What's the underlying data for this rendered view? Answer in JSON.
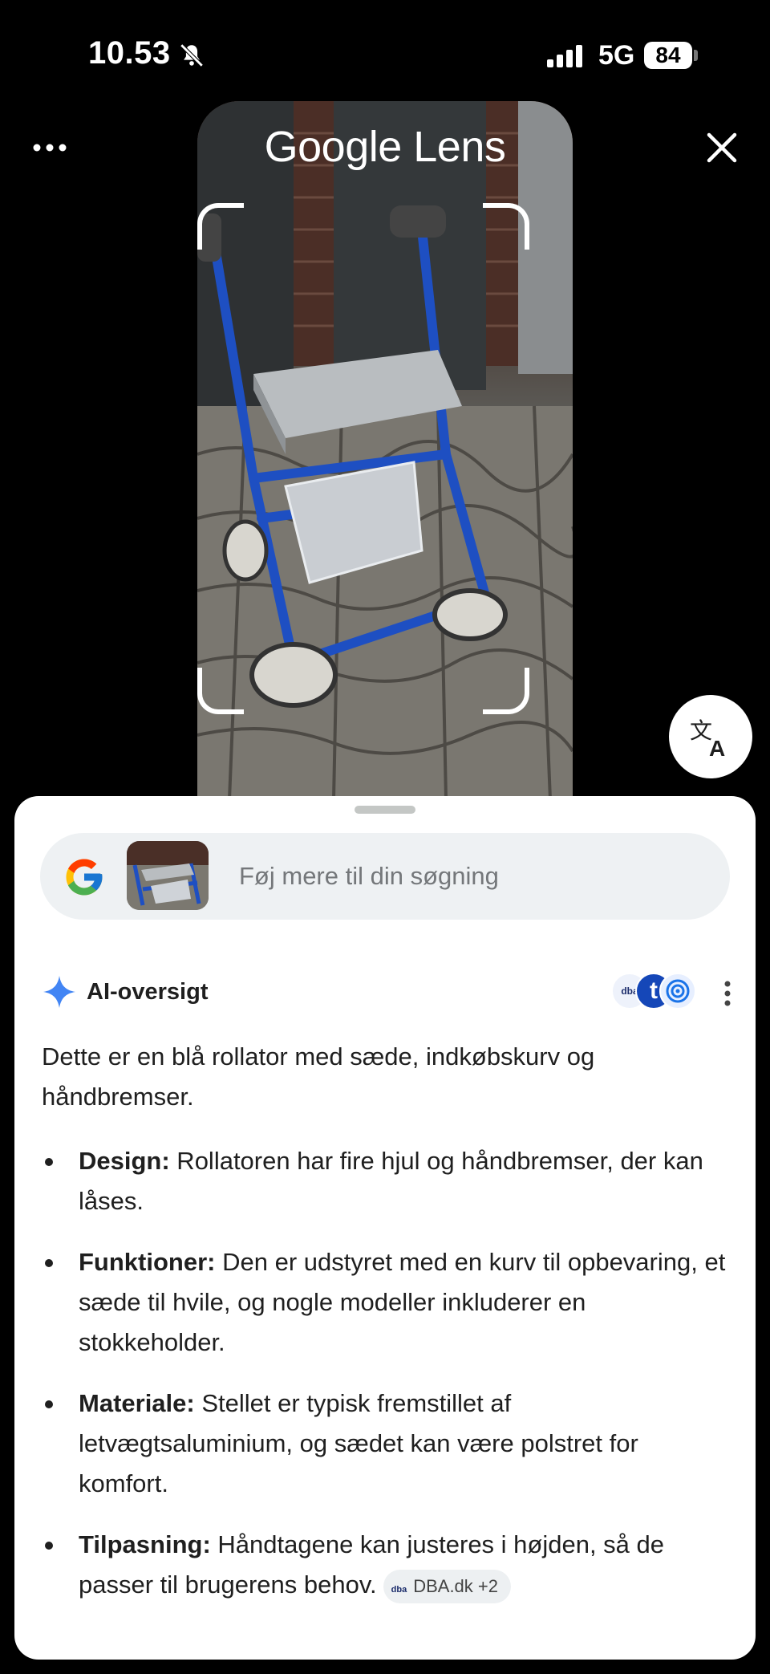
{
  "status_bar": {
    "time": "10.53",
    "network": "5G",
    "battery": "84"
  },
  "header": {
    "title": "Google Lens"
  },
  "search": {
    "placeholder": "Føj mere til din søgning"
  },
  "ai_overview": {
    "title": "AI-oversigt",
    "source_badges": [
      "dba",
      "t"
    ],
    "summary": "Dette er en blå rollator med sæde, indkøbskurv og håndbremser.",
    "bullets": [
      {
        "term": "Design:",
        "text": " Rollatoren har fire hjul og håndbremser, der kan låses."
      },
      {
        "term": "Funktioner:",
        "text": " Den er udstyret med en kurv til opbevaring, et sæde til hvile, og nogle modeller inkluderer en stokkeholder."
      },
      {
        "term": "Materiale:",
        "text": " Stellet er typisk fremstillet af letvægtsaluminium, og sædet kan være polstret for komfort."
      },
      {
        "term": "Tilpasning:",
        "text": " Håndtagene kan justeres i højden, så de passer til brugerens behov."
      }
    ],
    "citation_chip": {
      "icon_text": "dba",
      "label": "DBA.dk +2"
    }
  },
  "icons": {
    "more": "more-horizontal-icon",
    "close": "close-icon",
    "translate": "translate-icon",
    "google": "google-logo-icon",
    "sparkle": "ai-sparkle-icon",
    "kebab": "more-vertical-icon",
    "bell_off": "bell-off-icon",
    "signal": "signal-icon"
  },
  "colors": {
    "background": "#000000",
    "sheet": "#ffffff",
    "search_bar": "#eef1f3",
    "sparkle": "#4285f4",
    "dba_brand": "#1b2c6b"
  }
}
